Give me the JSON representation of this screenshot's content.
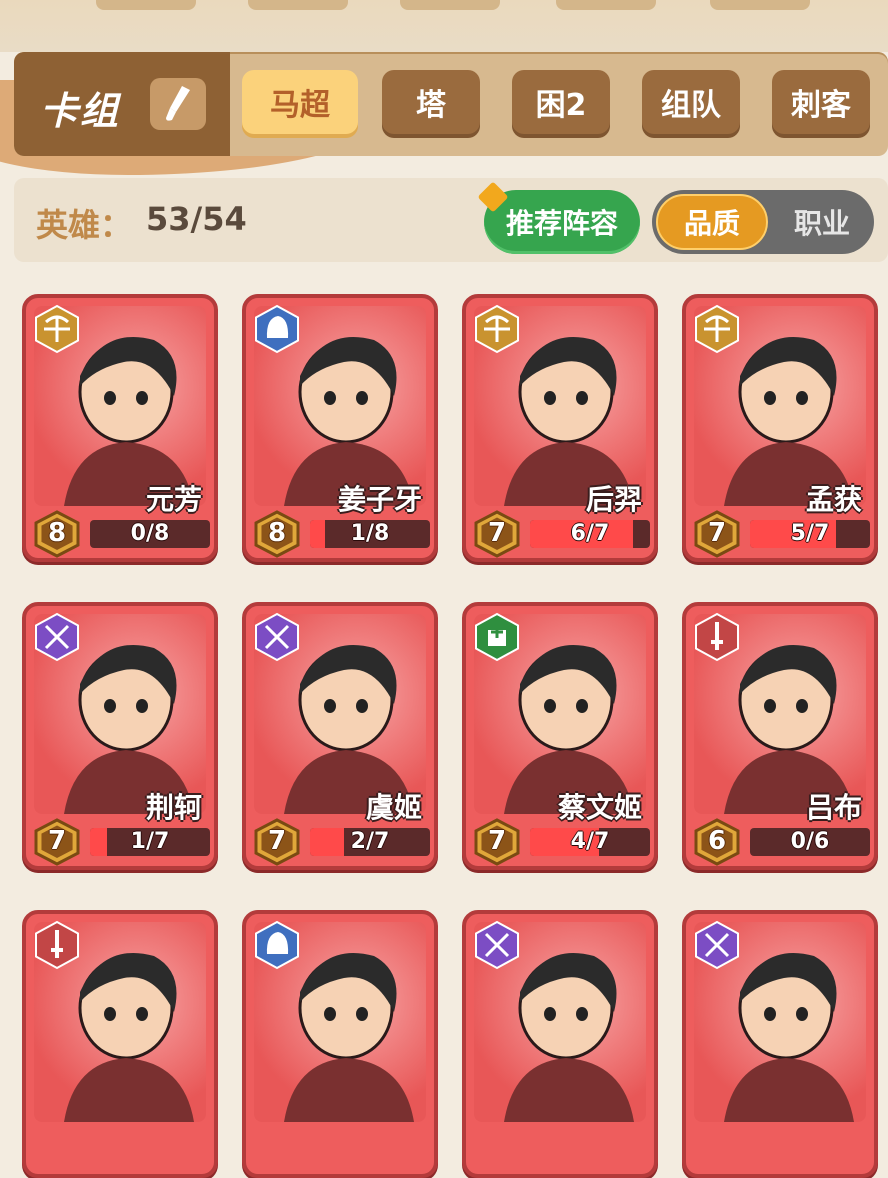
{
  "deck": {
    "label": "卡组",
    "edit_icon": "brush-icon",
    "tabs": [
      {
        "label": "马超",
        "active": true
      },
      {
        "label": "塔",
        "active": false
      },
      {
        "label": "困2",
        "active": false
      },
      {
        "label": "组队",
        "active": false
      },
      {
        "label": "刺客",
        "active": false
      }
    ]
  },
  "heroes": {
    "label": "英雄：",
    "count": "53/54",
    "recommend_label": "推荐阵容",
    "toggle": {
      "quality": "品质",
      "class": "职业",
      "selected": "quality"
    }
  },
  "colors": {
    "card_red": "#ee5d5d",
    "card_border": "#b33b3b",
    "badge_gold": "#c9932f",
    "badge_blue": "#3f6fbf",
    "badge_purple": "#7c4dc4",
    "badge_green": "#2f8f3f",
    "badge_red": "#c24646"
  },
  "cards": [
    {
      "name": "元芳",
      "level": "8",
      "progress": "0/8",
      "fill": 0,
      "class_icon": "crossbow-icon",
      "class_color": "gold",
      "art": "white-haired-warrior"
    },
    {
      "name": "姜子牙",
      "level": "8",
      "progress": "1/8",
      "fill": 0.125,
      "class_icon": "helmet-icon",
      "class_color": "blue",
      "art": "old-sage"
    },
    {
      "name": "后羿",
      "level": "7",
      "progress": "6/7",
      "fill": 0.857,
      "class_icon": "crossbow-icon",
      "class_color": "gold",
      "art": "archer"
    },
    {
      "name": "孟获",
      "level": "7",
      "progress": "5/7",
      "fill": 0.714,
      "class_icon": "crossbow-icon",
      "class_color": "gold",
      "art": "beast-warrior"
    },
    {
      "name": "荆轲",
      "level": "7",
      "progress": "1/7",
      "fill": 0.143,
      "class_icon": "crossed-swords-icon",
      "class_color": "purple",
      "art": "hooded-assassin"
    },
    {
      "name": "虞姬",
      "level": "7",
      "progress": "2/7",
      "fill": 0.286,
      "class_icon": "crossed-swords-icon",
      "class_color": "purple",
      "art": "swordswoman"
    },
    {
      "name": "蔡文姬",
      "level": "7",
      "progress": "4/7",
      "fill": 0.571,
      "class_icon": "healer-icon",
      "class_color": "green",
      "art": "musician"
    },
    {
      "name": "吕布",
      "level": "6",
      "progress": "0/6",
      "fill": 0,
      "class_icon": "sword-icon",
      "class_color": "red",
      "art": "general"
    },
    {
      "name": "",
      "level": "",
      "progress": "",
      "fill": 0,
      "class_icon": "sword-icon",
      "class_color": "red",
      "art": "fighter-girl"
    },
    {
      "name": "",
      "level": "",
      "progress": "",
      "fill": 0,
      "class_icon": "helmet-icon",
      "class_color": "blue",
      "art": "spiky-hair"
    },
    {
      "name": "",
      "level": "",
      "progress": "",
      "fill": 0,
      "class_icon": "crossed-swords-icon",
      "class_color": "purple",
      "art": "armored-rider"
    },
    {
      "name": "",
      "level": "",
      "progress": "",
      "fill": 0,
      "class_icon": "crossed-swords-icon",
      "class_color": "purple",
      "art": "monkey-king"
    }
  ]
}
